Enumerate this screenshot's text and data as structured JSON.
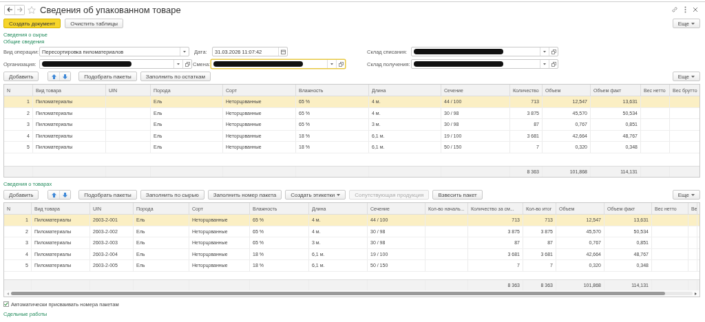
{
  "window": {
    "title": "Сведения об упакованном товаре"
  },
  "top_buttons": [
    {
      "label": "Создать документ",
      "kind": "primary"
    },
    {
      "label": "Очистить таблицы",
      "kind": "normal"
    }
  ],
  "top_more": "Еще",
  "raw_section": {
    "title": "Сведения о сырье",
    "subtitle": "Общие сведения",
    "fields": [
      {
        "label": "Вид операции:",
        "value": "Пересортировка пиломатериалов",
        "kind": "select",
        "redacted": false,
        "focused": false
      },
      {
        "label": "Дата:",
        "value": "31.03.2026 11:07:42",
        "kind": "date",
        "redacted": false,
        "focused": false
      },
      {
        "label": "Склад списания:",
        "kind": "select-open",
        "redacted": true,
        "focused": false
      },
      {
        "label": "Организация:",
        "kind": "select-open",
        "redacted": true,
        "focused": false
      },
      {
        "label": "Смена:",
        "kind": "select-open",
        "redacted": true,
        "focused": true
      },
      {
        "label": "Склад получения:",
        "kind": "select-open",
        "redacted": true,
        "focused": false
      }
    ],
    "toolbar": [
      {
        "kind": "button",
        "label": "Добавить",
        "disabled": false
      },
      {
        "kind": "arrows"
      },
      {
        "kind": "button",
        "label": "Подобрать пакеты",
        "disabled": false
      },
      {
        "kind": "button",
        "label": "Заполнить по остаткам",
        "disabled": false
      }
    ],
    "more": "Еще",
    "table": {
      "columns": [
        {
          "title": "N",
          "kind": "number"
        },
        {
          "title": "Вид товара",
          "kind": "text"
        },
        {
          "title": "UIN",
          "kind": "text"
        },
        {
          "title": "Порода",
          "kind": "text"
        },
        {
          "title": "Сорт",
          "kind": "text"
        },
        {
          "title": "Влажность",
          "kind": "text"
        },
        {
          "title": "Длина",
          "kind": "text"
        },
        {
          "title": "Сечение",
          "kind": "text"
        },
        {
          "title": "Количество",
          "kind": "number",
          "total": "8 363"
        },
        {
          "title": "Объем",
          "kind": "number",
          "total": "101,868"
        },
        {
          "title": "Объем факт",
          "kind": "number",
          "total": "114,131"
        },
        {
          "title": "Вес нетто",
          "kind": "number"
        },
        {
          "title": "Вес брутто",
          "kind": "number"
        }
      ],
      "rows": [
        {
          "selected": true,
          "cells": [
            "1",
            "Пиломатериалы",
            null,
            "Ель",
            "Неторцованные",
            "65 %",
            "4 м.",
            "44 / 100",
            "713",
            "12,547",
            "13,631",
            null,
            null
          ]
        },
        {
          "selected": false,
          "cells": [
            "2",
            "Пиломатериалы",
            null,
            "Ель",
            "Неторцованные",
            "65 %",
            "4 м.",
            "30 / 98",
            "3 875",
            "45,570",
            "50,534",
            null,
            null
          ]
        },
        {
          "selected": false,
          "cells": [
            "3",
            "Пиломатериалы",
            null,
            "Ель",
            "Неторцованные",
            "65 %",
            "3 м.",
            "30 / 98",
            "87",
            "0,767",
            "0,851",
            null,
            null
          ]
        },
        {
          "selected": false,
          "cells": [
            "4",
            "Пиломатериалы",
            null,
            "Ель",
            "Неторцованные",
            "18 %",
            "6,1 м.",
            "19 / 100",
            "3 681",
            "42,664",
            "48,767",
            null,
            null
          ]
        },
        {
          "selected": false,
          "cells": [
            "5",
            "Пиломатериалы",
            null,
            "Ель",
            "Неторцованные",
            "18 %",
            "6,1 м.",
            "50 / 150",
            "7",
            "0,320",
            "0,348",
            null,
            null
          ]
        }
      ]
    }
  },
  "goods_section": {
    "title": "Сведения о товарах",
    "toolbar": [
      {
        "kind": "button",
        "label": "Добавить",
        "disabled": false
      },
      {
        "kind": "arrows"
      },
      {
        "kind": "button",
        "label": "Подобрать пакеты",
        "disabled": false
      },
      {
        "kind": "button",
        "label": "Заполнить по сырью",
        "disabled": false
      },
      {
        "kind": "button",
        "label": "Заполнить номер пакета",
        "disabled": false
      },
      {
        "kind": "dropdown",
        "label": "Создать этикетки",
        "disabled": false
      },
      {
        "kind": "button",
        "label": "Сопутствующая продукция",
        "disabled": true
      },
      {
        "kind": "button",
        "label": "Взвесить пакет",
        "disabled": false
      }
    ],
    "more": "Еще",
    "table": {
      "columns": [
        {
          "title": "N",
          "kind": "number"
        },
        {
          "title": "Вид товара",
          "kind": "text"
        },
        {
          "title": "UIN",
          "kind": "text"
        },
        {
          "title": "Порода",
          "kind": "text"
        },
        {
          "title": "Сорт",
          "kind": "text"
        },
        {
          "title": "Влажность",
          "kind": "text"
        },
        {
          "title": "Длина",
          "kind": "text"
        },
        {
          "title": "Сечение",
          "kind": "text"
        },
        {
          "title": "Кол-во началь...",
          "kind": "number"
        },
        {
          "title": "Количество за см...",
          "kind": "number",
          "total": "8 363"
        },
        {
          "title": "Кол-во итог",
          "kind": "number",
          "total": "8 363"
        },
        {
          "title": "Объем",
          "kind": "number",
          "total": "101,868"
        },
        {
          "title": "Объем факт",
          "kind": "number",
          "total": "114,131"
        },
        {
          "title": "Вес нетто",
          "kind": "number"
        },
        {
          "title": "Ве",
          "kind": "text"
        }
      ],
      "rows": [
        {
          "selected": true,
          "cells": [
            "1",
            "Пиломатериалы",
            "2603-2-001",
            "Ель",
            "Неторцованные",
            "65 %",
            "4 м.",
            "44 / 100",
            null,
            "713",
            "713",
            "12,547",
            "13,631",
            null,
            null
          ]
        },
        {
          "selected": false,
          "cells": [
            "2",
            "Пиломатериалы",
            "2603-2-002",
            "Ель",
            "Неторцованные",
            "65 %",
            "4 м.",
            "30 / 98",
            null,
            "3 875",
            "3 875",
            "45,570",
            "50,534",
            null,
            null
          ]
        },
        {
          "selected": false,
          "cells": [
            "3",
            "Пиломатериалы",
            "2603-2-003",
            "Ель",
            "Неторцованные",
            "65 %",
            "3 м.",
            "30 / 98",
            null,
            "87",
            "87",
            "0,767",
            "0,851",
            null,
            null
          ]
        },
        {
          "selected": false,
          "cells": [
            "4",
            "Пиломатериалы",
            "2603-2-004",
            "Ель",
            "Неторцованные",
            "18 %",
            "6,1 м.",
            "19 / 100",
            null,
            "3 681",
            "3 681",
            "42,664",
            "48,767",
            null,
            null
          ]
        },
        {
          "selected": false,
          "cells": [
            "5",
            "Пиломатериалы",
            "2603-2-005",
            "Ель",
            "Неторцованные",
            "18 %",
            "6,1 м.",
            "50 / 150",
            null,
            "7",
            "7",
            "0,320",
            "0,348",
            null,
            null
          ]
        }
      ]
    }
  },
  "auto_numbering": {
    "label": "Автоматически присваивать номера пакетам",
    "checked": true
  },
  "footer_link": "Сдельные работы"
}
